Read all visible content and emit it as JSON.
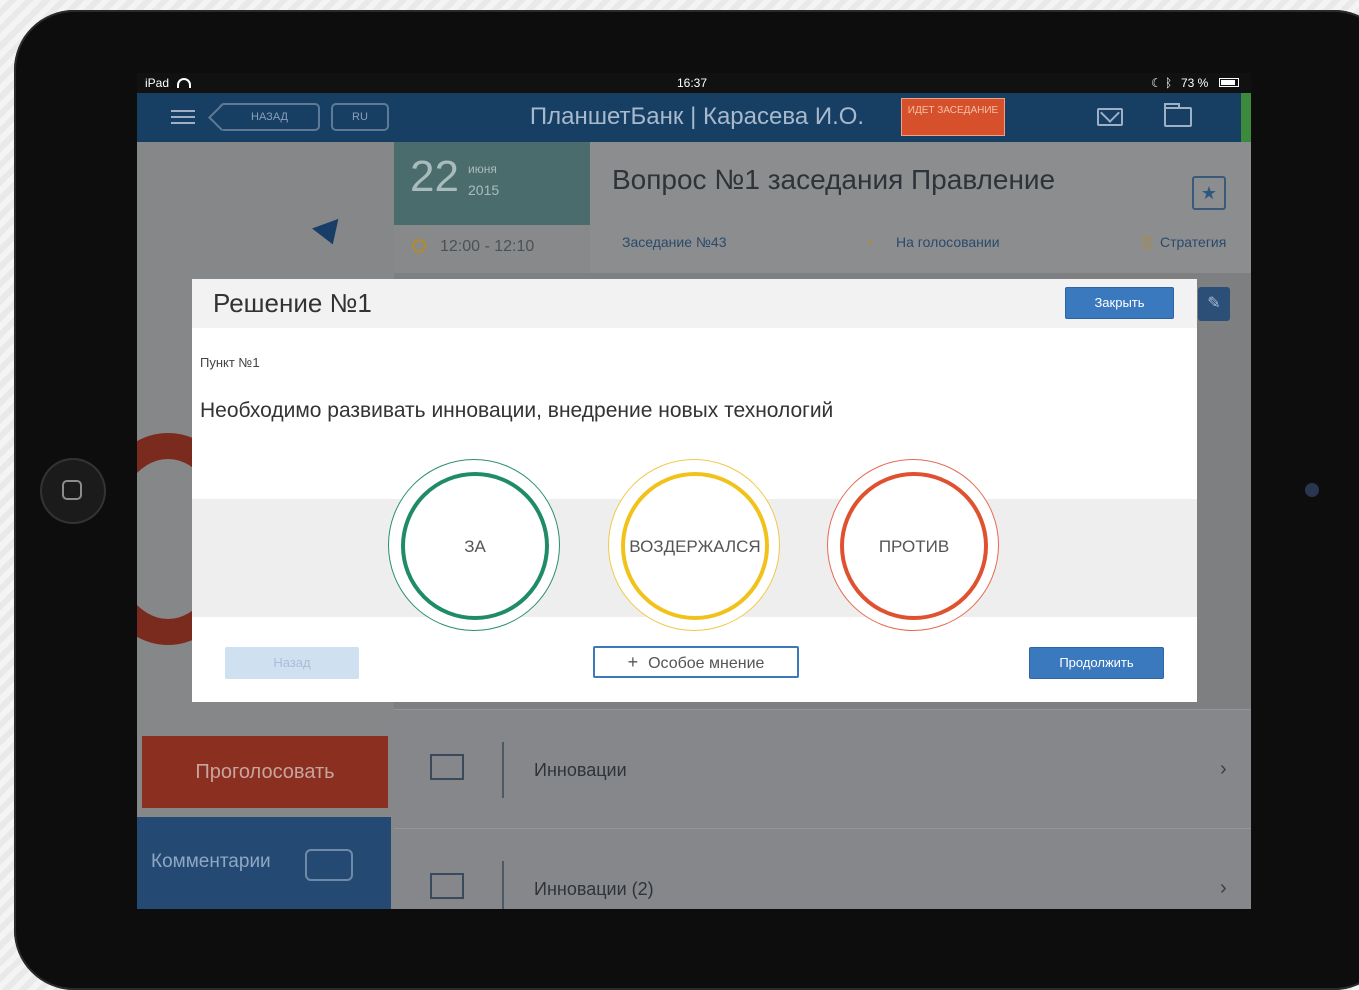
{
  "status_bar": {
    "device": "iPad",
    "time": "16:37",
    "battery": "73 %"
  },
  "header": {
    "back_label": "НАЗАД",
    "lang_label": "RU",
    "title": "ПланшетБанк | Карасева И.О.",
    "status_chip": "ИДЕТ ЗАСЕДАНИЕ"
  },
  "agenda": {
    "day": "22",
    "month": "июня",
    "year": "2015",
    "time": "12:00 - 12:10",
    "question_title": "Вопрос №1 заседания Правление",
    "meeting": "Заседание №43",
    "status": "На голосовании",
    "category": "Стратегия"
  },
  "left_panel": {
    "vote_button": "Проголосовать",
    "comments_button": "Комментарии"
  },
  "list": {
    "items": [
      {
        "label": "Инновации"
      },
      {
        "label": "Инновации (2)"
      }
    ]
  },
  "modal": {
    "title": "Решение №1",
    "close_button": "Закрыть",
    "point_label": "Пункт №1",
    "point_text": "Необходимо развивать инновации, внедрение новых технологий",
    "options": {
      "for": "ЗА",
      "abstain": "ВОЗДЕРЖАЛСЯ",
      "against": "ПРОТИВ"
    },
    "back_button": "Назад",
    "opinion_button": "Особое мнение",
    "continue_button": "Продолжить"
  },
  "colors": {
    "header_bg": "#173e63",
    "accent_blue": "#3b79be",
    "vote_for": "#1f8c67",
    "vote_abstain": "#f1c21b",
    "vote_against": "#e0512f",
    "status_chip": "#d6502b"
  }
}
